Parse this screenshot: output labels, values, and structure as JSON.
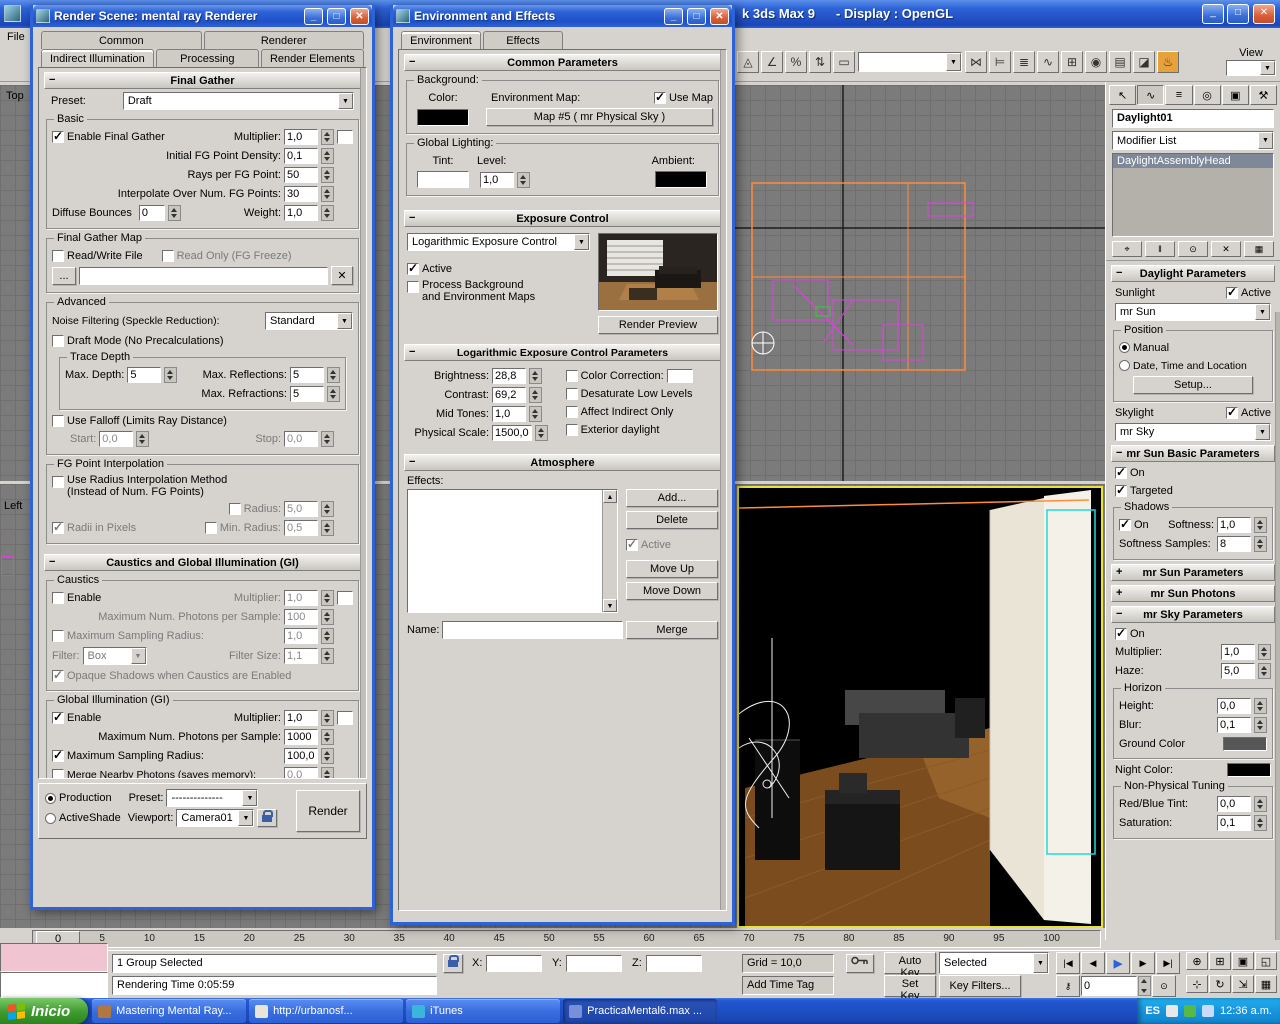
{
  "main": {
    "title_app": "k 3ds Max 9",
    "title_display": "- Display : OpenGL",
    "file_menu": "File",
    "top_label": "Top",
    "left_label": "Left"
  },
  "colors": {
    "accent_blue": "#2E63D8",
    "viewport_gray": "#7B7B7B",
    "active_viewport_border": "#E8E23A",
    "selection_cyan": "#1EDADA",
    "wireframe_orange": "#FF8B3D",
    "wireframe_magenta": "#E040E0"
  },
  "render": {
    "title": "Render Scene: mental ray Renderer",
    "tabs_top": [
      {
        "label": "Common",
        "data_name": "tab-common"
      },
      {
        "label": "Renderer",
        "data_name": "tab-renderer"
      }
    ],
    "tabs_bottom": [
      {
        "label": "Indirect Illumination",
        "data_name": "tab-indirect-illumination",
        "cls": "active"
      },
      {
        "label": "Processing",
        "data_name": "tab-processing"
      },
      {
        "label": "Render Elements",
        "data_name": "tab-render-elements"
      }
    ],
    "fg": {
      "title": "Final Gather",
      "preset_label": "Preset:",
      "preset": "Draft",
      "basic_title": "Basic",
      "enable": "Enable Final Gather",
      "mult_label": "Multiplier:",
      "mult": "1,0",
      "density_label": "Initial FG Point Density:",
      "density": "0,1",
      "rays_label": "Rays per FG Point:",
      "rays": "50",
      "interp_label": "Interpolate Over Num. FG Points:",
      "interp": "30",
      "bounces_label": "Diffuse Bounces",
      "bounces": "0",
      "weight_label": "Weight:",
      "weight": "1,0",
      "map_title": "Final Gather Map",
      "read_write": "Read/Write File",
      "read_only": "Read Only (FG Freeze)",
      "browse": "...",
      "clear": "✕",
      "adv_title": "Advanced",
      "noise_label": "Noise Filtering (Speckle Reduction):",
      "noise": "Standard",
      "draft_mode": "Draft Mode (No Precalculations)",
      "trace_title": "Trace Depth",
      "depth_label": "Max. Depth:",
      "depth": "5",
      "refl_label": "Max. Reflections:",
      "refl": "5",
      "refr_label": "Max. Refractions:",
      "refr": "5",
      "falloff": "Use Falloff (Limits Ray Distance)",
      "start_label": "Start:",
      "start": "0,0",
      "stop_label": "Stop:",
      "stop": "0,0",
      "fgi_title": "FG Point Interpolation",
      "use_radius_1": "Use Radius Interpolation Method",
      "use_radius_2": "(Instead of Num. FG Points)",
      "radius_label": "Radius:",
      "radius": "5,0",
      "radii_pixels": "Radii in Pixels",
      "min_radius_label": "Min. Radius:",
      "min_radius": "0,5"
    },
    "gi": {
      "title": "Caustics and Global Illumination (GI)",
      "caustics_title": "Caustics",
      "c_enable": "Enable",
      "c_mult_label": "Multiplier:",
      "c_mult": "1,0",
      "c_photons_label": "Maximum Num. Photons per Sample:",
      "c_photons": "100",
      "c_radius_label": "Maximum Sampling Radius:",
      "c_radius": "1,0",
      "filter_label": "Filter:",
      "filter": "Box",
      "filter_size_label": "Filter Size:",
      "filter_size": "1,1",
      "opaque": "Opaque Shadows when Caustics are Enabled",
      "gi_title": "Global Illumination (GI)",
      "g_enable": "Enable",
      "g_mult_label": "Multiplier:",
      "g_mult": "1,0",
      "g_photons_label": "Maximum Num. Photons per Sample:",
      "g_photons": "1000",
      "g_radius_label": "Maximum Sampling Radius:",
      "g_radius": "100,0",
      "merge_label": "Merge Nearby Photons (saves memory):",
      "merge": "0,0"
    },
    "footer": {
      "production": "Production",
      "activeshade": "ActiveShade",
      "preset_label": "Preset:",
      "preset": "--------------",
      "viewport_label": "Viewport:",
      "viewport": "Camera01",
      "render": "Render"
    }
  },
  "env": {
    "title": "Environment and Effects",
    "tabs": [
      {
        "label": "Environment",
        "data_name": "tab-environment",
        "cls": "active"
      },
      {
        "label": "Effects",
        "data_name": "tab-effects"
      }
    ],
    "common": {
      "title": "Common Parameters",
      "background_title": "Background:",
      "color_label": "Color:",
      "envmap_label": "Environment Map:",
      "use_map": "Use Map",
      "map_button": "Map #5 ( mr Physical Sky )",
      "global_title": "Global Lighting:",
      "tint_label": "Tint:",
      "level_label": "Level:",
      "level": "1,0",
      "ambient_label": "Ambient:"
    },
    "exposure": {
      "title": "Exposure Control",
      "type": "Logarithmic Exposure Control",
      "active": "Active",
      "process_1": "Process Background",
      "process_2": "and Environment Maps",
      "render_preview": "Render Preview"
    },
    "log": {
      "title": "Logarithmic Exposure Control Parameters",
      "brightness_label": "Brightness:",
      "brightness": "28,8",
      "contrast_label": "Contrast:",
      "contrast": "69,2",
      "mid_label": "Mid Tones:",
      "mid": "1,0",
      "phys_label": "Physical Scale:",
      "phys": "1500,0",
      "cc_label": "Color Correction:",
      "desat": "Desaturate Low Levels",
      "indirect": "Affect Indirect Only",
      "exterior": "Exterior daylight"
    },
    "atm": {
      "title": "Atmosphere",
      "effects_label": "Effects:",
      "add": "Add...",
      "delete": "Delete",
      "active": "Active",
      "move_up": "Move Up",
      "move_down": "Move Down",
      "name_label": "Name:",
      "merge": "Merge"
    }
  },
  "panel": {
    "tabs": [
      {
        "glyph": "↖",
        "data_name": "create-tab-icon"
      },
      {
        "glyph": "∿",
        "data_name": "modify-tab-icon",
        "cls": "active"
      },
      {
        "glyph": "≡",
        "data_name": "hierarchy-tab-icon"
      },
      {
        "glyph": "◎",
        "data_name": "motion-tab-icon"
      },
      {
        "glyph": "▣",
        "data_name": "display-tab-icon"
      },
      {
        "glyph": "⚒",
        "data_name": "utilities-tab-icon"
      }
    ],
    "object_name": "Daylight01",
    "modifier_list": "Modifier List",
    "stack_item": "DaylightAssemblyHead",
    "stack_buttons": [
      {
        "glyph": "⌖",
        "data_name": "pin-stack-icon"
      },
      {
        "glyph": "‖",
        "data_name": "show-end-result-icon"
      },
      {
        "glyph": "⊙",
        "data_name": "make-unique-icon"
      },
      {
        "glyph": "✕",
        "data_name": "remove-modifier-icon"
      },
      {
        "glyph": "▦",
        "data_name": "configure-modifier-sets-icon"
      }
    ],
    "daylight": {
      "title": "Daylight Parameters",
      "sunlight": "Sunlight",
      "active": "Active",
      "sun_type": "mr Sun",
      "position_title": "Position",
      "manual": "Manual",
      "date_loc": "Date, Time and Location",
      "setup": "Setup...",
      "skylight": "Skylight",
      "sky_type": "mr Sky"
    },
    "sun_basic": {
      "title": "mr Sun Basic Parameters",
      "on": "On",
      "targeted": "Targeted",
      "shadows_title": "Shadows",
      "shadow_on": "On",
      "softness_label": "Softness:",
      "softness": "1,0",
      "samples_label": "Softness Samples:",
      "samples": "8"
    },
    "sun_params_title": "mr Sun Parameters",
    "sun_photons_title": "mr Sun Photons",
    "sky": {
      "title": "mr Sky Parameters",
      "on": "On",
      "mult_label": "Multiplier:",
      "mult": "1,0",
      "haze_label": "Haze:",
      "haze": "5,0",
      "horizon_title": "Horizon",
      "height_label": "Height:",
      "height": "0,0",
      "blur_label": "Blur:",
      "blur": "0,1",
      "ground_label": "Ground Color",
      "night_label": "Night Color:",
      "tuning_title": "Non-Physical Tuning",
      "redblue_label": "Red/Blue Tint:",
      "redblue": "0,0",
      "sat_label": "Saturation:",
      "sat": "0,1"
    }
  },
  "toolbar": {
    "icons": [
      {
        "glyph": "◬",
        "data_name": "snaps-toggle-icon"
      },
      {
        "glyph": "∠",
        "data_name": "angle-snap-icon"
      },
      {
        "glyph": "%",
        "data_name": "percent-snap-icon"
      },
      {
        "glyph": "⇅",
        "data_name": "spinner-snap-icon"
      },
      {
        "glyph": "▭",
        "data_name": "edit-named-selections-icon"
      }
    ],
    "icons2": [
      {
        "glyph": "⋈",
        "data_name": "mirror-icon"
      },
      {
        "glyph": "⊨",
        "data_name": "align-icon"
      },
      {
        "glyph": "≣",
        "data_name": "layer-manager-icon"
      },
      {
        "glyph": "∿",
        "data_name": "curve-editor-icon"
      },
      {
        "glyph": "⊞",
        "data_name": "schematic-view-icon"
      },
      {
        "glyph": "◉",
        "data_name": "material-editor-icon"
      },
      {
        "glyph": "▤",
        "data_name": "render-scene-icon"
      },
      {
        "glyph": "◪",
        "data_name": "render-type-icon"
      },
      {
        "glyph": "♨",
        "data_name": "quick-render-icon",
        "cls": "hot"
      }
    ],
    "view_label": "View"
  },
  "timeline": {
    "labels": [
      "0",
      "5",
      "10",
      "15",
      "20",
      "25",
      "30",
      "35",
      "40",
      "45",
      "50",
      "55",
      "60",
      "65",
      "70",
      "75",
      "80",
      "85",
      "90",
      "95",
      "100"
    ],
    "slider_value": "0"
  },
  "status": {
    "selection": "1 Group Selected",
    "rendering_time": "Rendering Time  0:05:59",
    "x_label": "X:",
    "y_label": "Y:",
    "z_label": "Z:",
    "grid": "Grid = 10,0",
    "add_time_tag": "Add Time Tag",
    "auto_key": "Auto Key",
    "set_key": "Set Key",
    "selected": "Selected",
    "key_filters": "Key Filters...",
    "frame": "0",
    "playback": [
      {
        "glyph": "|◀",
        "data_name": "go-to-start-icon"
      },
      {
        "glyph": "◀",
        "data_name": "previous-frame-icon"
      },
      {
        "glyph": "▶",
        "data_name": "play-icon",
        "cls": "play"
      },
      {
        "glyph": "▶",
        "data_name": "next-frame-icon"
      },
      {
        "glyph": "▶|",
        "data_name": "go-to-end-icon"
      }
    ],
    "nav": [
      {
        "glyph": "⊕",
        "data_name": "zoom-icon"
      },
      {
        "glyph": "⊞",
        "data_name": "zoom-all-icon"
      },
      {
        "glyph": "▣",
        "data_name": "zoom-extents-icon"
      },
      {
        "glyph": "◱",
        "data_name": "zoom-region-icon"
      },
      {
        "glyph": "⊹",
        "data_name": "pan-icon"
      },
      {
        "glyph": "↻",
        "data_name": "arc-rotate-icon"
      },
      {
        "glyph": "⇲",
        "data_name": "min-max-toggle-icon"
      },
      {
        "glyph": "▦",
        "data_name": "zoom-extents-all-icon"
      }
    ]
  },
  "taskbar": {
    "start": "Inicio",
    "tasks": [
      {
        "label": "Mastering Mental Ray...",
        "data_name": "task-mastering-mental-ray",
        "cls": "t1"
      },
      {
        "label": "http://urbanosf...",
        "data_name": "task-browser",
        "cls": "t2"
      },
      {
        "label": "iTunes",
        "data_name": "task-itunes",
        "cls": "t3"
      },
      {
        "label": "PracticaMental6.max ...",
        "data_name": "task-practica-mental",
        "cls": "t4 active"
      }
    ],
    "language": "ES",
    "time": "12:36 a.m."
  }
}
